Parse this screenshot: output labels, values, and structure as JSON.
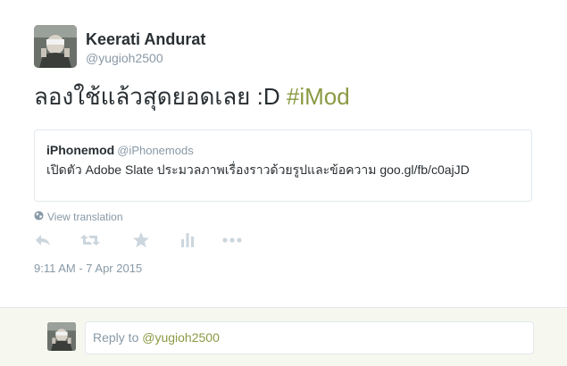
{
  "tweet": {
    "author": {
      "display_name": "Keerati Andurat",
      "screen_name": "@yugioh2500"
    },
    "text_plain": "ลองใช้แล้วสุดยอดเลย :D ",
    "hashtag": "#iMod",
    "quoted": {
      "name": "iPhonemod",
      "handle": "@iPhonemods",
      "text": "เปิดตัว Adobe Slate ประมวลภาพเรื่องราวด้วยรูปและข้อความ goo.gl/fb/c0ajJD"
    },
    "view_translation": "View translation",
    "actions": [
      {
        "name": "reply",
        "icon": "reply-icon"
      },
      {
        "name": "retweet",
        "icon": "retweet-icon"
      },
      {
        "name": "favorite",
        "icon": "star-icon"
      },
      {
        "name": "analytics",
        "icon": "bar-chart-icon"
      },
      {
        "name": "more",
        "icon": "more-dots-icon"
      }
    ],
    "timestamp": "9:11 AM - 7 Apr 2015"
  },
  "reply": {
    "prefix": "Reply to ",
    "mention": "@yugioh2500"
  },
  "colors": {
    "text": "#292f33",
    "muted": "#8899a6",
    "hashtag": "#8a9a44",
    "icon": "#ccd6dd",
    "border": "#e1e8ed",
    "reply_bg": "#f6f7ee"
  }
}
